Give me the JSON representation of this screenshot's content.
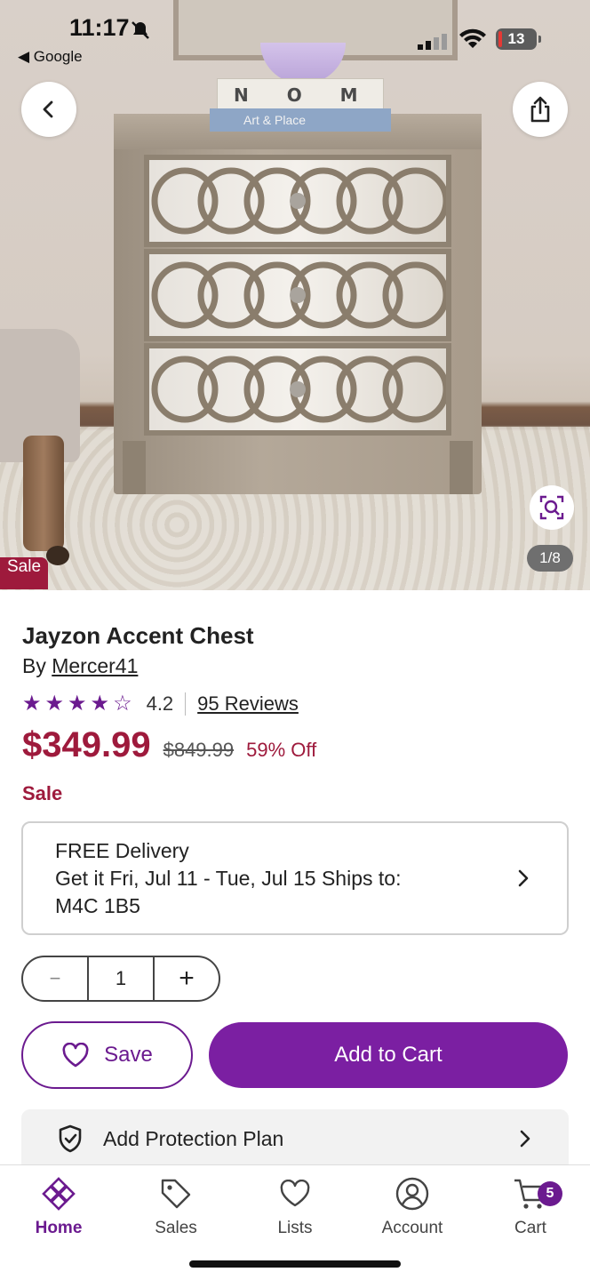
{
  "status_bar": {
    "time": "11:17",
    "back_app": "◀ Google",
    "battery": "13"
  },
  "hero": {
    "image_counter": "1/8",
    "sale_tag": "Sale",
    "book_spine_text": "N O M A",
    "book_title": "Art & Place"
  },
  "product": {
    "title": "Jayzon Accent Chest",
    "by_prefix": "By",
    "brand": "Mercer41",
    "rating": 4.2,
    "rating_text": "4.2",
    "reviews_link": "95 Reviews",
    "price": "$349.99",
    "old_price": "$849.99",
    "discount": "59% Off",
    "sale_label": "Sale"
  },
  "delivery": {
    "line1": "FREE Delivery",
    "line2": "Get it Fri, Jul 11 - Tue, Jul 15 Ships to:",
    "line3": "M4C 1B5"
  },
  "quantity": {
    "minus": "−",
    "value": "1",
    "plus": "+"
  },
  "actions": {
    "save_label": "Save",
    "add_to_cart_label": "Add to Cart",
    "protection_label": "Add Protection Plan"
  },
  "nav": {
    "items": [
      {
        "label": "Home",
        "icon": "home-icon",
        "active": true
      },
      {
        "label": "Sales",
        "icon": "tag-icon"
      },
      {
        "label": "Lists",
        "icon": "heart-icon"
      },
      {
        "label": "Account",
        "icon": "account-icon"
      },
      {
        "label": "Cart",
        "icon": "cart-icon"
      }
    ],
    "cart_badge": "5"
  },
  "colors": {
    "brand_purple": "#7b1fa2",
    "sale_red": "#9e1a3c"
  }
}
